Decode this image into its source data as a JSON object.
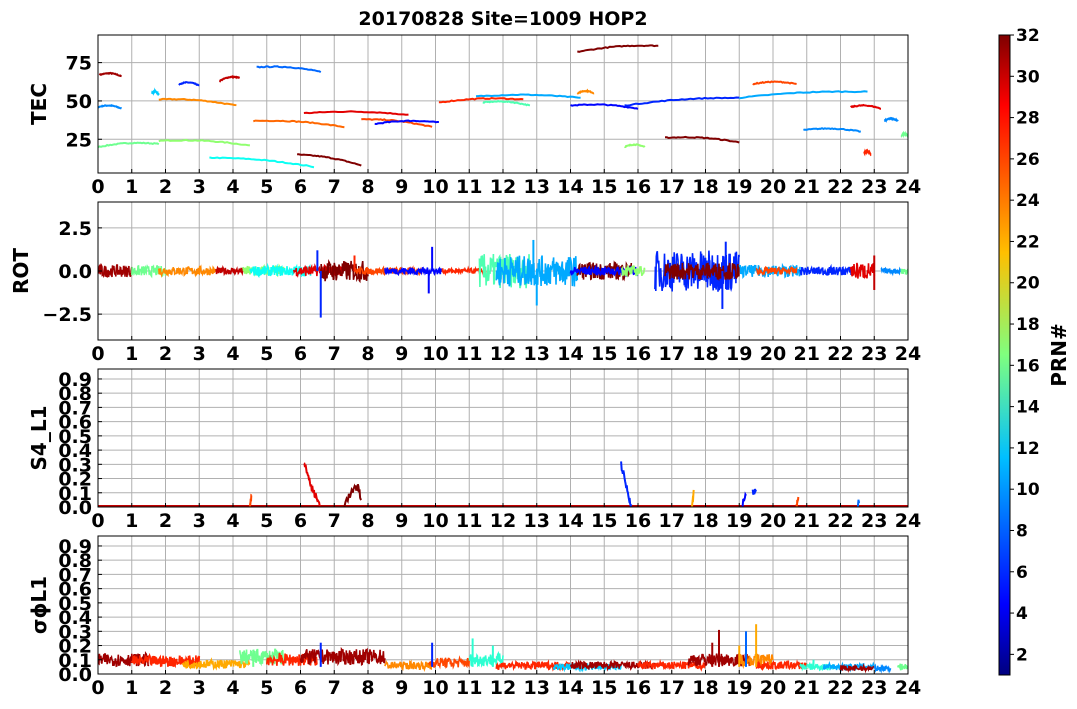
{
  "title": "20170828 Site=1009 HOP2",
  "colorbar": {
    "label": "PRN#",
    "ticks": [
      2,
      4,
      6,
      8,
      10,
      12,
      14,
      16,
      18,
      20,
      22,
      24,
      26,
      28,
      30,
      32
    ],
    "range": [
      1,
      32
    ],
    "colormap": "jet"
  },
  "chart_data": [
    {
      "type": "line",
      "panel": "TEC",
      "ylabel": "TEC",
      "xlim": [
        0,
        24
      ],
      "ylim": [
        3,
        93
      ],
      "x_ticks": [
        "0",
        "1",
        "2",
        "3",
        "4",
        "5",
        "6",
        "7",
        "8",
        "9",
        "10",
        "11",
        "12",
        "13",
        "14",
        "15",
        "16",
        "17",
        "18",
        "19",
        "20",
        "21",
        "22",
        "23",
        "24"
      ],
      "y_ticks": [
        "25",
        "50",
        "75"
      ],
      "y_tick_values": [
        25,
        50,
        75
      ],
      "grid": true,
      "series": [
        {
          "prn": 31,
          "x": [
            0.05,
            0.7
          ],
          "y": [
            67,
            66
          ]
        },
        {
          "prn": 9,
          "x": [
            0.0,
            0.7
          ],
          "y": [
            46,
            45
          ]
        },
        {
          "prn": 16,
          "x": [
            0.0,
            1.8
          ],
          "y": [
            20,
            22
          ]
        },
        {
          "prn": 11,
          "x": [
            1.6,
            1.8
          ],
          "y": [
            55,
            54
          ]
        },
        {
          "prn": 24,
          "x": [
            1.8,
            4.1
          ],
          "y": [
            51,
            47
          ]
        },
        {
          "prn": 17,
          "x": [
            1.8,
            4.5
          ],
          "y": [
            24,
            21
          ]
        },
        {
          "prn": 6,
          "x": [
            2.4,
            3.0
          ],
          "y": [
            61,
            60
          ]
        },
        {
          "prn": 13,
          "x": [
            3.3,
            6.4
          ],
          "y": [
            13,
            7
          ]
        },
        {
          "prn": 30,
          "x": [
            3.6,
            4.2
          ],
          "y": [
            63,
            65
          ]
        },
        {
          "prn": 8,
          "x": [
            4.7,
            6.6
          ],
          "y": [
            72,
            69
          ]
        },
        {
          "prn": 25,
          "x": [
            4.6,
            7.3
          ],
          "y": [
            37,
            33
          ]
        },
        {
          "prn": 32,
          "x": [
            5.9,
            7.8
          ],
          "y": [
            15,
            8
          ]
        },
        {
          "prn": 29,
          "x": [
            6.1,
            9.2
          ],
          "y": [
            42,
            41
          ]
        },
        {
          "prn": 26,
          "x": [
            7.8,
            9.9
          ],
          "y": [
            38,
            33
          ]
        },
        {
          "prn": 5,
          "x": [
            8.2,
            10.1
          ],
          "y": [
            35,
            36
          ]
        },
        {
          "prn": 27,
          "x": [
            10.1,
            12.6
          ],
          "y": [
            49,
            51
          ]
        },
        {
          "prn": 15,
          "x": [
            11.4,
            12.8
          ],
          "y": [
            49,
            47
          ]
        },
        {
          "prn": 10,
          "x": [
            11.2,
            14.3
          ],
          "y": [
            53,
            52
          ]
        },
        {
          "prn": 32,
          "x": [
            14.2,
            16.6
          ],
          "y": [
            82,
            86
          ]
        },
        {
          "prn": 24,
          "x": [
            14.2,
            14.7
          ],
          "y": [
            55,
            55
          ]
        },
        {
          "prn": 5,
          "x": [
            14.0,
            16.0
          ],
          "y": [
            47,
            45
          ]
        },
        {
          "prn": 17,
          "x": [
            15.6,
            16.2
          ],
          "y": [
            20,
            20
          ]
        },
        {
          "prn": 6,
          "x": [
            15.6,
            19.0
          ],
          "y": [
            47,
            52
          ]
        },
        {
          "prn": 32,
          "x": [
            16.8,
            19.0
          ],
          "y": [
            26,
            23
          ]
        },
        {
          "prn": 10,
          "x": [
            19.0,
            22.8
          ],
          "y": [
            52,
            56
          ]
        },
        {
          "prn": 26,
          "x": [
            19.4,
            20.7
          ],
          "y": [
            61,
            61
          ]
        },
        {
          "prn": 9,
          "x": [
            20.9,
            22.6
          ],
          "y": [
            31,
            30
          ]
        },
        {
          "prn": 29,
          "x": [
            22.3,
            23.2
          ],
          "y": [
            46,
            45
          ]
        },
        {
          "prn": 27,
          "x": [
            22.7,
            22.9
          ],
          "y": [
            16,
            15
          ]
        },
        {
          "prn": 9,
          "x": [
            23.3,
            23.7
          ],
          "y": [
            37,
            37
          ]
        },
        {
          "prn": 16,
          "x": [
            23.8,
            24.0
          ],
          "y": [
            27,
            27
          ]
        }
      ]
    },
    {
      "type": "line",
      "panel": "ROT",
      "ylabel": "ROT",
      "xlim": [
        0,
        24
      ],
      "ylim": [
        -4,
        4
      ],
      "x_ticks": [
        "0",
        "1",
        "2",
        "3",
        "4",
        "5",
        "6",
        "7",
        "8",
        "9",
        "10",
        "11",
        "12",
        "13",
        "14",
        "15",
        "16",
        "17",
        "18",
        "19",
        "20",
        "21",
        "22",
        "23",
        "24"
      ],
      "y_ticks": [
        "−2.5",
        "0.0",
        "2.5"
      ],
      "y_tick_values": [
        -2.5,
        0,
        2.5
      ],
      "grid": true,
      "series": [
        {
          "prn": 31,
          "x": [
            0.0,
            1.0
          ],
          "amp": 0.35
        },
        {
          "prn": 16,
          "x": [
            1.0,
            2.0
          ],
          "amp": 0.3
        },
        {
          "prn": 24,
          "x": [
            1.8,
            3.5
          ],
          "amp": 0.25
        },
        {
          "prn": 30,
          "x": [
            3.5,
            4.3
          ],
          "amp": 0.2
        },
        {
          "prn": 17,
          "x": [
            4.3,
            5.5
          ],
          "amp": 0.3
        },
        {
          "prn": 13,
          "x": [
            4.5,
            6.3
          ],
          "amp": 0.3
        },
        {
          "prn": 29,
          "x": [
            5.8,
            7.2
          ],
          "amp": 0.3
        },
        {
          "prn": 32,
          "x": [
            6.6,
            8.0
          ],
          "amp": 0.6
        },
        {
          "prn": 26,
          "x": [
            7.6,
            9.6
          ],
          "amp": 0.2
        },
        {
          "prn": 5,
          "x": [
            8.5,
            10.2
          ],
          "amp": 0.2
        },
        {
          "prn": 27,
          "x": [
            10.2,
            11.5
          ],
          "amp": 0.15
        },
        {
          "prn": 15,
          "x": [
            11.3,
            12.8
          ],
          "amp": 1.0
        },
        {
          "prn": 10,
          "x": [
            11.8,
            14.2
          ],
          "amp": 0.9
        },
        {
          "prn": 32,
          "x": [
            14.2,
            15.8
          ],
          "amp": 0.5
        },
        {
          "prn": 5,
          "x": [
            14.0,
            16.0
          ],
          "amp": 0.25
        },
        {
          "prn": 17,
          "x": [
            15.5,
            16.2
          ],
          "amp": 0.3
        },
        {
          "prn": 6,
          "x": [
            16.5,
            19.0
          ],
          "amp": 1.2
        },
        {
          "prn": 32,
          "x": [
            16.8,
            19.0
          ],
          "amp": 0.5
        },
        {
          "prn": 10,
          "x": [
            19.0,
            20.8
          ],
          "amp": 0.35
        },
        {
          "prn": 26,
          "x": [
            19.5,
            20.7
          ],
          "amp": 0.2
        },
        {
          "prn": 6,
          "x": [
            20.8,
            22.4
          ],
          "amp": 0.25
        },
        {
          "prn": 29,
          "x": [
            22.3,
            23.0
          ],
          "amp": 0.5
        },
        {
          "prn": 9,
          "x": [
            23.2,
            23.8
          ],
          "amp": 0.15
        },
        {
          "prn": 16,
          "x": [
            23.8,
            24.0
          ],
          "amp": 0.2
        }
      ],
      "spikes": [
        {
          "x": 6.6,
          "y": -2.7,
          "prn": 6
        },
        {
          "x": 6.5,
          "y": 1.2,
          "prn": 6
        },
        {
          "x": 9.9,
          "y": 1.4,
          "prn": 5
        },
        {
          "x": 9.8,
          "y": -1.3,
          "prn": 5
        },
        {
          "x": 13.0,
          "y": -2.0,
          "prn": 10
        },
        {
          "x": 12.9,
          "y": 1.8,
          "prn": 10
        },
        {
          "x": 18.5,
          "y": -2.2,
          "prn": 6
        },
        {
          "x": 18.6,
          "y": 1.7,
          "prn": 6
        },
        {
          "x": 23.0,
          "y": -1.1,
          "prn": 30
        },
        {
          "x": 23.0,
          "y": 0.9,
          "prn": 30
        },
        {
          "x": 7.6,
          "y": 0.9,
          "prn": 27
        }
      ]
    },
    {
      "type": "line",
      "panel": "S4_L1",
      "ylabel": "S4_L1",
      "xlim": [
        0,
        24
      ],
      "ylim": [
        0,
        0.97
      ],
      "x_ticks": [
        "0",
        "1",
        "2",
        "3",
        "4",
        "5",
        "6",
        "7",
        "8",
        "9",
        "10",
        "11",
        "12",
        "13",
        "14",
        "15",
        "16",
        "17",
        "18",
        "19",
        "20",
        "21",
        "22",
        "23",
        "24"
      ],
      "y_ticks": [
        "0.0",
        "0.1",
        "0.2",
        "0.3",
        "0.4",
        "0.5",
        "0.6",
        "0.7",
        "0.8",
        "0.9"
      ],
      "y_tick_values": [
        0,
        0.1,
        0.2,
        0.3,
        0.4,
        0.5,
        0.6,
        0.7,
        0.8,
        0.9
      ],
      "grid": true,
      "series": [
        {
          "prn": 29,
          "x": [
            6.1,
            6.2,
            6.3,
            6.4,
            6.5,
            6.6
          ],
          "y": [
            0.3,
            0.25,
            0.15,
            0.1,
            0.05,
            0.0
          ]
        },
        {
          "prn": 32,
          "x": [
            7.3,
            7.5,
            7.6,
            7.7,
            7.8
          ],
          "y": [
            0.02,
            0.1,
            0.12,
            0.15,
            0.05
          ]
        },
        {
          "prn": 6,
          "x": [
            15.5,
            15.6,
            15.7,
            15.8
          ],
          "y": [
            0.3,
            0.2,
            0.1,
            0.02
          ]
        },
        {
          "prn": 26,
          "x": [
            4.5,
            4.55
          ],
          "y": [
            0.0,
            0.08
          ]
        },
        {
          "prn": 23,
          "x": [
            17.6,
            17.65
          ],
          "y": [
            0.0,
            0.12
          ]
        },
        {
          "prn": 5,
          "x": [
            19.1,
            19.2
          ],
          "y": [
            0.02,
            0.08
          ]
        },
        {
          "prn": 6,
          "x": [
            19.4,
            19.5
          ],
          "y": [
            0.1,
            0.12
          ]
        },
        {
          "prn": 26,
          "x": [
            20.7,
            20.75
          ],
          "y": [
            0.0,
            0.07
          ]
        },
        {
          "prn": 8,
          "x": [
            22.5,
            22.55
          ],
          "y": [
            0.0,
            0.04
          ]
        }
      ],
      "baseline": 0.005
    },
    {
      "type": "line",
      "panel": "sigma_phi_L1",
      "ylabel": "σϕL1",
      "xlim": [
        0,
        24
      ],
      "ylim": [
        0,
        0.97
      ],
      "x_ticks": [
        "0",
        "1",
        "2",
        "3",
        "4",
        "5",
        "6",
        "7",
        "8",
        "9",
        "10",
        "11",
        "12",
        "13",
        "14",
        "15",
        "16",
        "17",
        "18",
        "19",
        "20",
        "21",
        "22",
        "23",
        "24"
      ],
      "y_ticks": [
        "0.0",
        "0.1",
        "0.2",
        "0.3",
        "0.4",
        "0.5",
        "0.6",
        "0.7",
        "0.8",
        "0.9"
      ],
      "y_tick_values": [
        0,
        0.1,
        0.2,
        0.3,
        0.4,
        0.5,
        0.6,
        0.7,
        0.8,
        0.9
      ],
      "grid": true,
      "series": [
        {
          "prn": 31,
          "x": [
            0.0,
            1.5
          ],
          "base": 0.1
        },
        {
          "prn": 27,
          "x": [
            1.0,
            3.0
          ],
          "base": 0.09
        },
        {
          "prn": 23,
          "x": [
            2.5,
            4.5
          ],
          "base": 0.07
        },
        {
          "prn": 16,
          "x": [
            4.2,
            5.5
          ],
          "base": 0.12
        },
        {
          "prn": 27,
          "x": [
            5.0,
            6.5
          ],
          "base": 0.1
        },
        {
          "prn": 31,
          "x": [
            6.0,
            8.5
          ],
          "base": 0.12
        },
        {
          "prn": 24,
          "x": [
            8.5,
            10.0
          ],
          "base": 0.06
        },
        {
          "prn": 26,
          "x": [
            9.8,
            11.0
          ],
          "base": 0.08
        },
        {
          "prn": 14,
          "x": [
            11.0,
            12.0
          ],
          "base": 0.1
        },
        {
          "prn": 27,
          "x": [
            11.8,
            14.0
          ],
          "base": 0.06
        },
        {
          "prn": 11,
          "x": [
            13.5,
            15.5
          ],
          "base": 0.05
        },
        {
          "prn": 31,
          "x": [
            14.0,
            16.5
          ],
          "base": 0.06
        },
        {
          "prn": 27,
          "x": [
            16.0,
            18.0
          ],
          "base": 0.06
        },
        {
          "prn": 31,
          "x": [
            17.5,
            19.3
          ],
          "base": 0.1
        },
        {
          "prn": 24,
          "x": [
            19.0,
            20.0
          ],
          "base": 0.1
        },
        {
          "prn": 27,
          "x": [
            19.5,
            21.0
          ],
          "base": 0.06
        },
        {
          "prn": 14,
          "x": [
            20.8,
            21.8
          ],
          "base": 0.05
        },
        {
          "prn": 10,
          "x": [
            21.5,
            23.0
          ],
          "base": 0.05
        },
        {
          "prn": 31,
          "x": [
            22.0,
            23.0
          ],
          "base": 0.04
        },
        {
          "prn": 9,
          "x": [
            23.0,
            23.5
          ],
          "base": 0.04
        },
        {
          "prn": 16,
          "x": [
            23.7,
            24.0
          ],
          "base": 0.05
        }
      ],
      "spikes": [
        {
          "x": 4.6,
          "y": 0.17,
          "prn": 16
        },
        {
          "x": 6.6,
          "y": 0.22,
          "prn": 6
        },
        {
          "x": 9.9,
          "y": 0.22,
          "prn": 6
        },
        {
          "x": 11.1,
          "y": 0.25,
          "prn": 14
        },
        {
          "x": 11.7,
          "y": 0.2,
          "prn": 14
        },
        {
          "x": 18.4,
          "y": 0.31,
          "prn": 31
        },
        {
          "x": 18.2,
          "y": 0.22,
          "prn": 31
        },
        {
          "x": 19.2,
          "y": 0.3,
          "prn": 8
        },
        {
          "x": 19.5,
          "y": 0.35,
          "prn": 23
        },
        {
          "x": 19.0,
          "y": 0.2,
          "prn": 23
        },
        {
          "x": 21.2,
          "y": 0.1,
          "prn": 14
        }
      ]
    }
  ]
}
